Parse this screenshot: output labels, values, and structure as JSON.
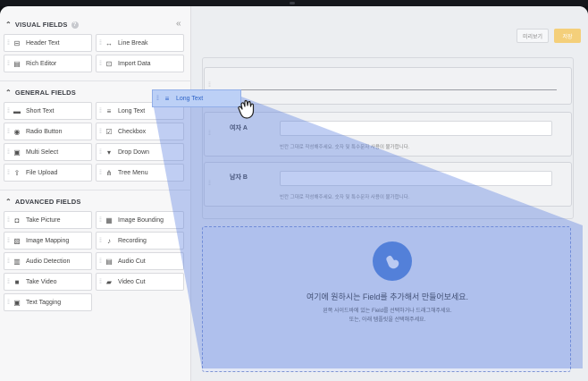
{
  "sidebar": {
    "collapse_glyph": "«",
    "sections": [
      {
        "title": "VISUAL FIELDS",
        "help": "?"
      },
      {
        "title": "GENERAL FIELDS"
      },
      {
        "title": "ADVANCED FIELDS"
      }
    ],
    "visual_fields": [
      {
        "label": "Header Text",
        "icon": "header-text-icon"
      },
      {
        "label": "Line Break",
        "icon": "line-break-icon"
      },
      {
        "label": "Rich Editor",
        "icon": "rich-editor-icon"
      },
      {
        "label": "Import Data",
        "icon": "import-data-icon"
      }
    ],
    "general_fields": [
      {
        "label": "Short Text",
        "icon": "short-text-icon"
      },
      {
        "label": "Long Text",
        "icon": "long-text-icon"
      },
      {
        "label": "Radio Button",
        "icon": "radio-button-icon"
      },
      {
        "label": "Checkbox",
        "icon": "checkbox-icon"
      },
      {
        "label": "Multi Select",
        "icon": "multi-select-icon"
      },
      {
        "label": "Drop Down",
        "icon": "drop-down-icon"
      },
      {
        "label": "File Upload",
        "icon": "file-upload-icon"
      },
      {
        "label": "Tree Menu",
        "icon": "tree-menu-icon"
      }
    ],
    "advanced_fields": [
      {
        "label": "Take Picture",
        "icon": "camera-icon"
      },
      {
        "label": "Image Bounding",
        "icon": "image-bounding-icon"
      },
      {
        "label": "Image Mapping",
        "icon": "image-mapping-icon"
      },
      {
        "label": "Recording",
        "icon": "microphone-icon"
      },
      {
        "label": "Audio Detection",
        "icon": "audio-detection-icon"
      },
      {
        "label": "Audio Cut",
        "icon": "audio-cut-icon"
      },
      {
        "label": "Take Video",
        "icon": "video-camera-icon"
      },
      {
        "label": "Video Cut",
        "icon": "video-cut-icon"
      },
      {
        "label": "Text Tagging",
        "icon": "text-tagging-icon"
      }
    ]
  },
  "toolbar": {
    "preview_label": "미리보기",
    "save_label": "저장"
  },
  "form": {
    "questions": [
      {
        "label": "여자 A",
        "hint": "빈칸 그대로 작성해주세요. 숫자 및 특수문자 사용이 불가합니다."
      },
      {
        "label": "남자 B",
        "hint": "빈칸 그대로 작성해주세요. 숫자 및 특수문자 사용이 불가합니다."
      }
    ]
  },
  "dropzone": {
    "title": "여기에 원하시는 Field를 추가해서 만들어보세요.",
    "line1": "왼쪽 사이드바에 있는 Field를 선택하거나 드래그해주세요.",
    "line2": "또는, 아래 템플릿을 선택해주세요."
  },
  "drag": {
    "label": "Long Text",
    "icon": "long-text-icon"
  },
  "colors": {
    "accent": "#4f82d6",
    "save": "#f4cf7a",
    "highlight": "#bcd0f6"
  }
}
